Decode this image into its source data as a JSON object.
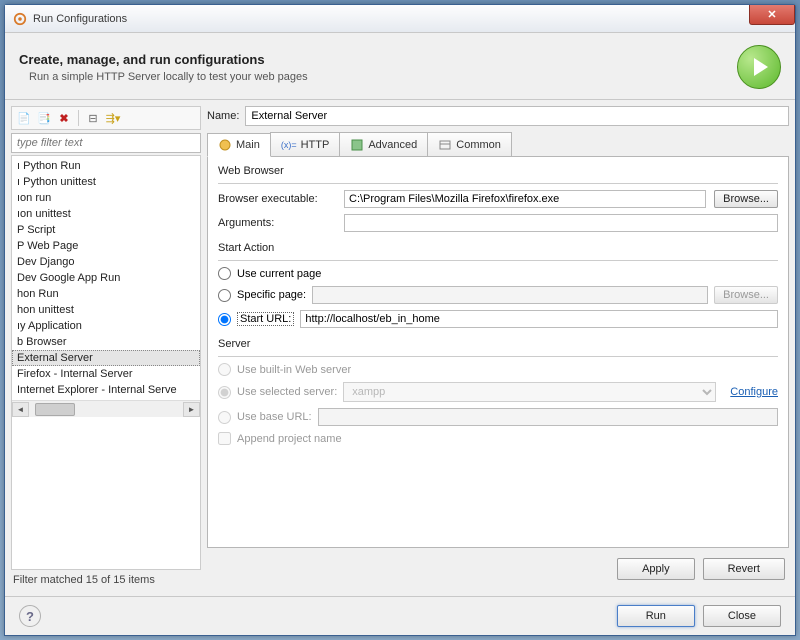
{
  "window": {
    "title": "Run Configurations"
  },
  "header": {
    "title": "Create, manage, and run configurations",
    "subtitle": "Run a simple HTTP Server locally to test your web pages"
  },
  "filter": {
    "placeholder": "type filter text",
    "status": "Filter matched 15 of 15 items"
  },
  "tree": {
    "items": [
      "ı Python Run",
      "ı Python unittest",
      "ıon run",
      "ıon unittest",
      "P Script",
      "P Web Page",
      "Dev Django",
      "Dev Google App Run",
      "hon Run",
      "hon unittest",
      "ıy Application",
      "b Browser",
      "External Server",
      "Firefox - Internal Server",
      "Internet Explorer - Internal Serve"
    ],
    "selected_index": 12
  },
  "name": {
    "label": "Name:",
    "value": "External Server"
  },
  "tabs": {
    "main": "Main",
    "http": "HTTP",
    "advanced": "Advanced",
    "common": "Common"
  },
  "web_browser": {
    "group": "Web Browser",
    "exec_label": "Browser executable:",
    "exec_value": "C:\\Program Files\\Mozilla Firefox\\firefox.exe",
    "browse": "Browse...",
    "args_label": "Arguments:",
    "args_value": ""
  },
  "start_action": {
    "group": "Start Action",
    "use_current": "Use current page",
    "specific_page": "Specific page:",
    "specific_value": "",
    "browse": "Browse...",
    "start_url": "Start URL:",
    "start_url_value": "http://localhost/eb_in_home"
  },
  "server": {
    "group": "Server",
    "builtin": "Use built-in Web server",
    "selected": "Use selected server:",
    "selected_value": "xampp",
    "configure": "Configure",
    "base_url": "Use base URL:",
    "base_url_value": "",
    "append": "Append project name"
  },
  "buttons": {
    "apply": "Apply",
    "revert": "Revert",
    "run": "Run",
    "close": "Close"
  }
}
